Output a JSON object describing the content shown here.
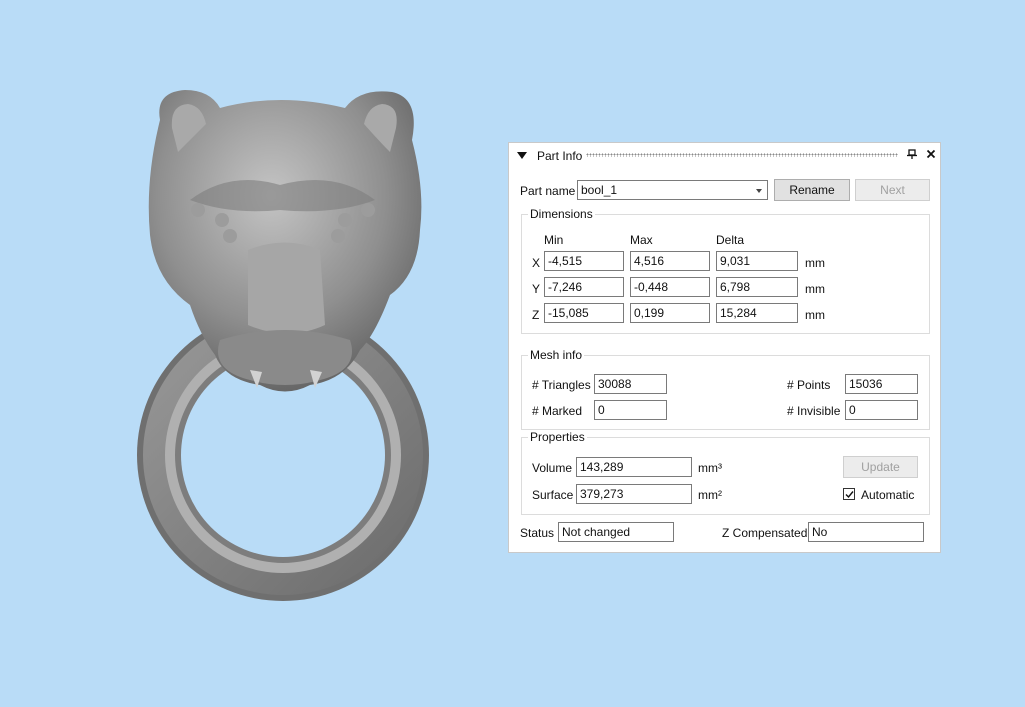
{
  "panel": {
    "title": "Part Info",
    "part_name_label": "Part name",
    "part_name_value": "bool_1",
    "rename_label": "Rename",
    "next_label": "Next"
  },
  "dimensions": {
    "title": "Dimensions",
    "headers": {
      "min": "Min",
      "max": "Max",
      "delta": "Delta"
    },
    "rows": [
      {
        "axis": "X",
        "min": "-4,515",
        "max": "4,516",
        "delta": "9,031",
        "unit": "mm"
      },
      {
        "axis": "Y",
        "min": "-7,246",
        "max": "-0,448",
        "delta": "6,798",
        "unit": "mm"
      },
      {
        "axis": "Z",
        "min": "-15,085",
        "max": "0,199",
        "delta": "15,284",
        "unit": "mm"
      }
    ]
  },
  "mesh": {
    "title": "Mesh info",
    "triangles_label": "# Triangles",
    "triangles_value": "30088",
    "points_label": "# Points",
    "points_value": "15036",
    "marked_label": "# Marked",
    "marked_value": "0",
    "invisible_label": "# Invisible",
    "invisible_value": "0"
  },
  "properties": {
    "title": "Properties",
    "volume_label": "Volume",
    "volume_value": "143,289",
    "volume_unit": "mm³",
    "surface_label": "Surface",
    "surface_value": "379,273",
    "surface_unit": "mm²",
    "update_label": "Update",
    "automatic_label": "Automatic",
    "automatic_checked": true
  },
  "status": {
    "status_label": "Status",
    "status_value": "Not changed",
    "zcomp_label": "Z Compensated",
    "zcomp_value": "No"
  },
  "colors": {
    "background": "#b9dcf7",
    "model_gray": "#8c8c8c"
  }
}
